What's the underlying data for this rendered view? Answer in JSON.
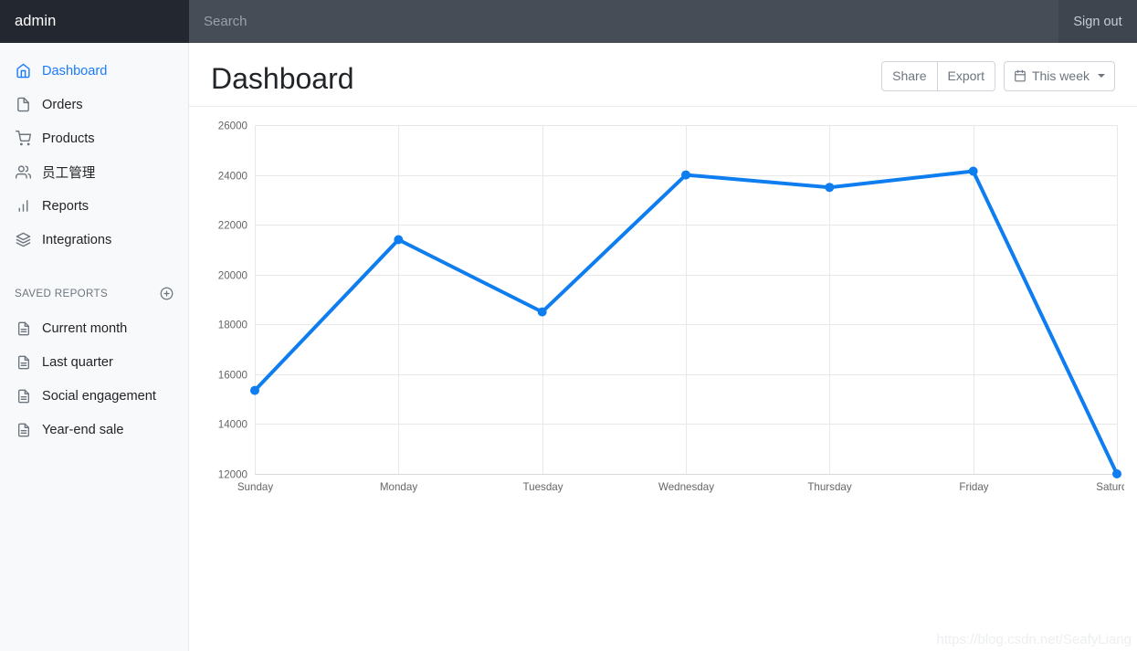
{
  "navbar": {
    "brand": "admin",
    "search_placeholder": "Search",
    "search_value": "",
    "sign_out": "Sign out"
  },
  "sidebar": {
    "items": [
      {
        "label": "Dashboard",
        "icon": "home-icon",
        "active": true
      },
      {
        "label": "Orders",
        "icon": "file-icon",
        "active": false
      },
      {
        "label": "Products",
        "icon": "shopping-cart-icon",
        "active": false
      },
      {
        "label": "员工管理",
        "icon": "users-icon",
        "active": false
      },
      {
        "label": "Reports",
        "icon": "bar-chart-icon",
        "active": false
      },
      {
        "label": "Integrations",
        "icon": "layers-icon",
        "active": false
      }
    ],
    "saved_reports": {
      "title": "SAVED REPORTS",
      "add_icon": "plus-circle-icon",
      "items": [
        {
          "label": "Current month",
          "icon": "file-text-icon"
        },
        {
          "label": "Last quarter",
          "icon": "file-text-icon"
        },
        {
          "label": "Social engagement",
          "icon": "file-text-icon"
        },
        {
          "label": "Year-end sale",
          "icon": "file-text-icon"
        }
      ]
    }
  },
  "main": {
    "page_title": "Dashboard",
    "toolbar": {
      "share": "Share",
      "export": "Export",
      "date_range": "This week",
      "date_icon": "calendar-icon",
      "caret_icon": "chevron-down-icon"
    }
  },
  "watermark": "https://blog.csdn.net/SeafyLiang",
  "colors": {
    "accent": "#1a7bff",
    "line": "#0d7df0",
    "navbar": "#474d56",
    "brand_bg": "#232730",
    "sidebar_bg": "#f8f9fa",
    "grid": "#e8e8e8",
    "tick_text": "#666666"
  },
  "chart_data": {
    "type": "line",
    "title": "",
    "xlabel": "",
    "ylabel": "",
    "categories": [
      "Sunday",
      "Monday",
      "Tuesday",
      "Wednesday",
      "Thursday",
      "Friday",
      "Saturday"
    ],
    "values": [
      15350,
      21400,
      18500,
      24000,
      23500,
      24150,
      12000
    ],
    "series": [
      {
        "name": "",
        "values": [
          15350,
          21400,
          18500,
          24000,
          23500,
          24150,
          12000
        ]
      }
    ],
    "ylim": [
      12000,
      26000
    ],
    "yticks": [
      12000,
      14000,
      16000,
      18000,
      20000,
      22000,
      24000,
      26000
    ],
    "ytick_labels": [
      "12000",
      "14000",
      "16000",
      "18000",
      "20000",
      "22000",
      "24000",
      "26000"
    ],
    "grid": true,
    "legend": false,
    "line_color": "#0d7df0",
    "line_width": 4,
    "point_radius": 5,
    "fill": false
  }
}
